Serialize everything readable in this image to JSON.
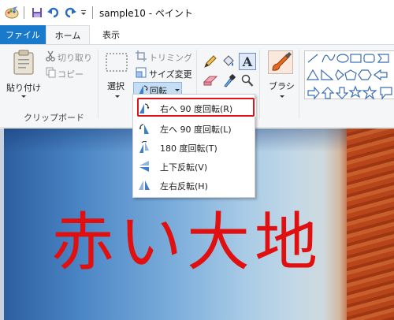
{
  "app": {
    "title": "sample10 - ペイント",
    "colors": {
      "accent": "#1979ca",
      "highlight_border": "#e0141a",
      "text_red": "#e01010"
    }
  },
  "quick_access": {
    "icons": [
      "paint-app-icon",
      "save-icon",
      "undo-icon",
      "redo-icon",
      "customize-dropdown-icon"
    ]
  },
  "tabs": {
    "file": "ファイル",
    "home": "ホーム",
    "view": "表示"
  },
  "ribbon": {
    "clipboard": {
      "paste": "貼り付け",
      "cut": "切り取り",
      "copy": "コピー",
      "group_label": "クリップボード"
    },
    "image": {
      "select": "選択",
      "crop": "トリミング",
      "resize": "サイズ変更",
      "rotate": "回転"
    },
    "tools": {
      "brush": "ブラシ"
    }
  },
  "rotate_menu": {
    "items": [
      {
        "label": "右へ 90 度回転(R)",
        "icon": "rotate-right-icon",
        "highlighted": true
      },
      {
        "label": "左へ 90 度回転(L)",
        "icon": "rotate-left-icon",
        "highlighted": false
      },
      {
        "label": "180 度回転(T)",
        "icon": "rotate-180-icon",
        "highlighted": false
      },
      {
        "label": "上下反転(V)",
        "icon": "flip-vertical-icon",
        "highlighted": false
      },
      {
        "label": "左右反転(H)",
        "icon": "flip-horizontal-icon",
        "highlighted": false
      }
    ]
  },
  "canvas": {
    "text": "赤い大地"
  }
}
